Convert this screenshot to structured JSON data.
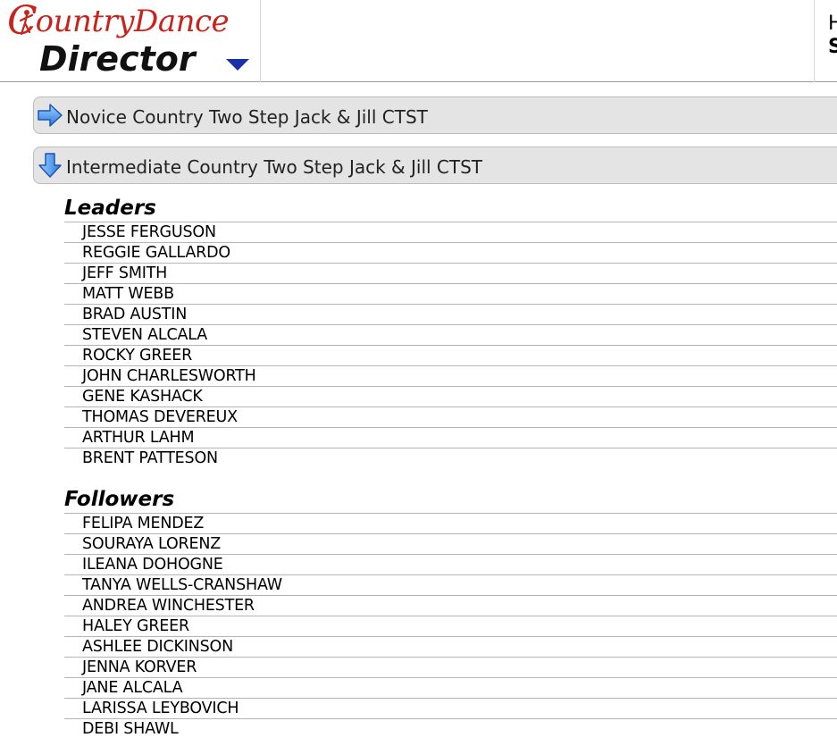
{
  "header": {
    "logo_top": "ountryDance",
    "logo_c": "C",
    "logo_bottom": "Director",
    "right_line1": "H",
    "right_line2": "S"
  },
  "divisions": [
    {
      "label": "Novice Country Two Step Jack & Jill CTST",
      "state": "collapsed",
      "icon": "arrow-right-icon"
    },
    {
      "label": "Intermediate Country Two Step Jack & Jill CTST",
      "state": "expanded",
      "icon": "arrow-down-icon"
    }
  ],
  "leaders": {
    "title": "Leaders",
    "names": [
      "JESSE FERGUSON",
      "REGGIE GALLARDO",
      "JEFF SMITH",
      "MATT WEBB",
      "BRAD AUSTIN",
      "STEVEN ALCALA",
      "ROCKY GREER",
      "JOHN CHARLESWORTH",
      "GENE KASHACK",
      "THOMAS DEVEREUX",
      "ARTHUR LAHM",
      "BRENT PATTESON"
    ]
  },
  "followers": {
    "title": "Followers",
    "names": [
      "FELIPA MENDEZ",
      "SOURAYA LORENZ",
      "ILEANA DOHOGNE",
      "TANYA WELLS-CRANSHAW",
      "ANDREA WINCHESTER",
      "HALEY GREER",
      "ASHLEE DICKINSON",
      "JENNA KORVER",
      "JANE ALCALA",
      "LARISSA LEYBOVICH",
      "DEBI SHAWL"
    ]
  },
  "colors": {
    "brand_red": "#c8241c",
    "accent_blue": "#1a2fa8",
    "accordion_bg": "#e4e4e4"
  }
}
